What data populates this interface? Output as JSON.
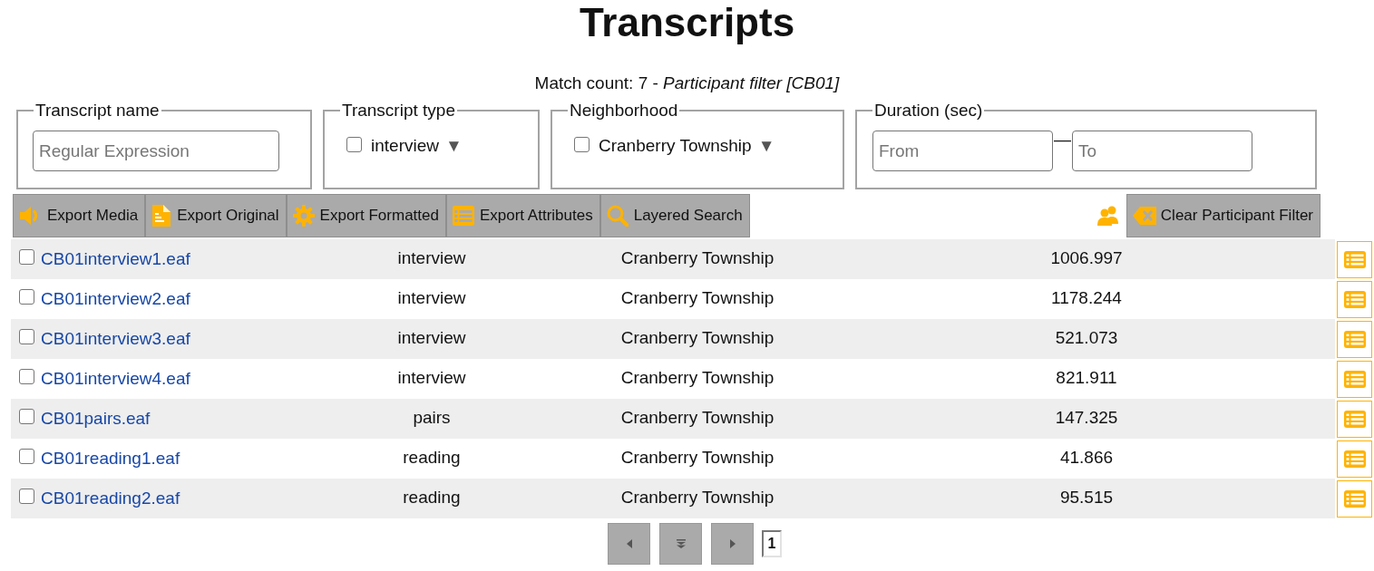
{
  "page": {
    "title": "Transcripts",
    "summary": "Match count: 7 - *Participant filter [CB01]*"
  },
  "filters": [
    {
      "kind": "text",
      "legend": "Transcript name",
      "placeholder": "Regular Expression"
    },
    {
      "kind": "choice",
      "legend": "Transcript type",
      "option": "interview",
      "checked": false,
      "arrow": "▼"
    },
    {
      "kind": "choice",
      "legend": "Neighborhood",
      "option": "Cranberry Township",
      "checked": false,
      "arrow": "▼"
    },
    {
      "kind": "range",
      "legend": "Duration (sec)",
      "from": {
        "placeholder": "From"
      },
      "separator": "—",
      "to": {
        "placeholder": "To"
      }
    }
  ],
  "toolbar": [
    {
      "kind": "media",
      "label": "Export Media"
    },
    {
      "kind": "original",
      "label": "Export Original"
    },
    {
      "kind": "formatted",
      "label": "Export Formatted"
    },
    {
      "kind": "attributes",
      "label": "Export Attributes"
    },
    {
      "kind": "search",
      "label": "Layered Search"
    }
  ],
  "participant_filter": {
    "clear_label": "Clear Participant Filter"
  },
  "rows": [
    {
      "name": "CB01interview1.eaf",
      "checked": false,
      "type": "interview",
      "neighborhood": "Cranberry Township",
      "duration": "1006.997"
    },
    {
      "name": "CB01interview2.eaf",
      "checked": false,
      "type": "interview",
      "neighborhood": "Cranberry Township",
      "duration": "1178.244"
    },
    {
      "name": "CB01interview3.eaf",
      "checked": false,
      "type": "interview",
      "neighborhood": "Cranberry Township",
      "duration": "521.073"
    },
    {
      "name": "CB01interview4.eaf",
      "checked": false,
      "type": "interview",
      "neighborhood": "Cranberry Township",
      "duration": "821.911"
    },
    {
      "name": "CB01pairs.eaf",
      "checked": false,
      "type": "pairs",
      "neighborhood": "Cranberry Township",
      "duration": "147.325"
    },
    {
      "name": "CB01reading1.eaf",
      "checked": false,
      "type": "reading",
      "neighborhood": "Cranberry Township",
      "duration": "41.866"
    },
    {
      "name": "CB01reading2.eaf",
      "checked": false,
      "type": "reading",
      "neighborhood": "Cranberry Township",
      "duration": "95.515"
    }
  ],
  "pagination": {
    "page": "1"
  }
}
